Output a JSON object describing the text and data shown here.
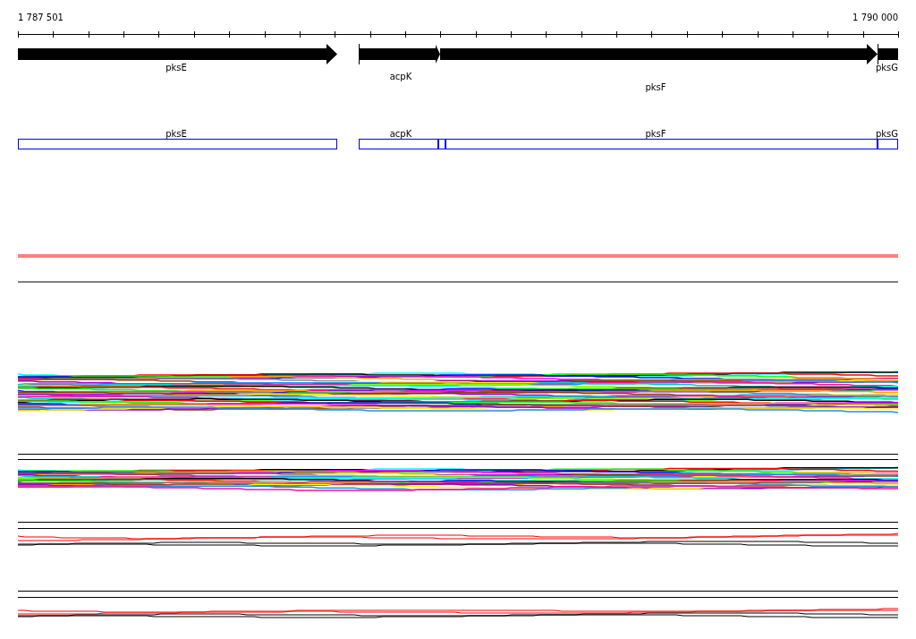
{
  "ruler": {
    "start_label": "1 787 501",
    "end_label": "1 790 000"
  },
  "gene_track": {
    "genes": [
      {
        "name": "pksE"
      },
      {
        "name": "acpK"
      },
      {
        "name": "pksF"
      },
      {
        "name": "pksG"
      }
    ]
  },
  "feature_track": {
    "features": [
      {
        "name": "pksE"
      },
      {
        "name": "acpK"
      },
      {
        "name": "pksF"
      },
      {
        "name": "pksG"
      }
    ]
  }
}
